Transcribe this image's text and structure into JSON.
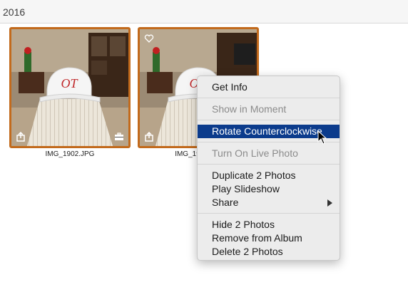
{
  "header": {
    "year": "2016"
  },
  "photos": [
    {
      "filename": "IMG_1902.JPG",
      "cap_text": "OT"
    },
    {
      "filename": "IMG_19",
      "cap_text": "OT"
    }
  ],
  "context_menu": {
    "get_info": "Get Info",
    "show_in_moment": "Show in Moment",
    "rotate_ccw": "Rotate Counterclockwise",
    "turn_on_live": "Turn On Live Photo",
    "duplicate": "Duplicate 2 Photos",
    "play_slideshow": "Play Slideshow",
    "share": "Share",
    "hide": "Hide 2 Photos",
    "remove_album": "Remove from Album",
    "delete": "Delete 2 Photos"
  },
  "colors": {
    "selection_border": "#c26a1c",
    "menu_highlight": "#0b3b8c"
  }
}
